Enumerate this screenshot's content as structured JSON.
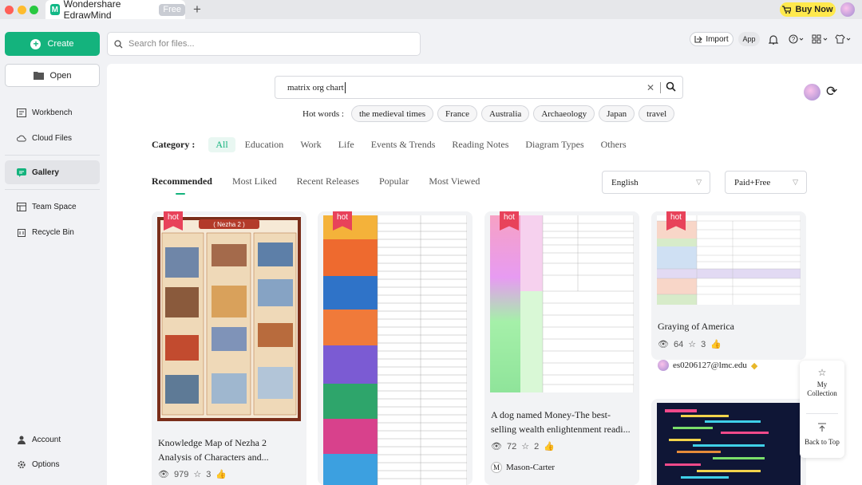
{
  "titlebar": {
    "app_title": "Wondershare EdrawMind",
    "free_badge": "Free",
    "new_tab": "+",
    "buy_now": "Buy Now"
  },
  "topbar": {
    "create_label": "Create",
    "search_placeholder": "Search for files...",
    "import_label": "Import",
    "app_label": "App"
  },
  "sidebar": {
    "open_label": "Open",
    "items": [
      {
        "label": "Workbench"
      },
      {
        "label": "Cloud Files"
      },
      {
        "label": "Gallery"
      },
      {
        "label": "Team Space"
      },
      {
        "label": "Recycle Bin"
      },
      {
        "label": "Account"
      },
      {
        "label": "Options"
      }
    ]
  },
  "gallery": {
    "search_value": "matrix org chart",
    "hot_words_label": "Hot words :",
    "hot_words": [
      "the medieval times",
      "France",
      "Australia",
      "Archaeology",
      "Japan",
      "travel"
    ],
    "category_label": "Category :",
    "categories": [
      "All",
      "Education",
      "Work",
      "Life",
      "Events & Trends",
      "Reading Notes",
      "Diagram Types",
      "Others"
    ],
    "sort_tabs": [
      "Recommended",
      "Most Liked",
      "Recent Releases",
      "Popular",
      "Most Viewed"
    ],
    "language": "English",
    "price_filter": "Paid+Free",
    "hot_badge": "hot"
  },
  "cards": [
    {
      "title_line1": "Knowledge Map of Nezha 2",
      "title_line2": "Analysis of Characters and...",
      "views": "979",
      "stars": "3",
      "thumb_title": "( Nezha 2 )"
    },
    {
      "title_line1": "",
      "title_line2": "",
      "views": "",
      "stars": ""
    },
    {
      "title_line1": "A dog named Money-The best-",
      "title_line2": "selling wealth enlightenment readi...",
      "views": "72",
      "stars": "2",
      "author": "Mason-Carter",
      "author_initial": "M"
    },
    {
      "title_line1": "Graying of America",
      "views": "64",
      "stars": "3",
      "author": "es0206127@lmc.edu"
    }
  ],
  "float_panel": {
    "collection_line1": "My",
    "collection_line2": "Collection",
    "back_to_top": "Back to Top"
  },
  "colors": {
    "accent": "#14b37d",
    "hot": "#e8425a",
    "buy_now": "#ffe94d"
  }
}
